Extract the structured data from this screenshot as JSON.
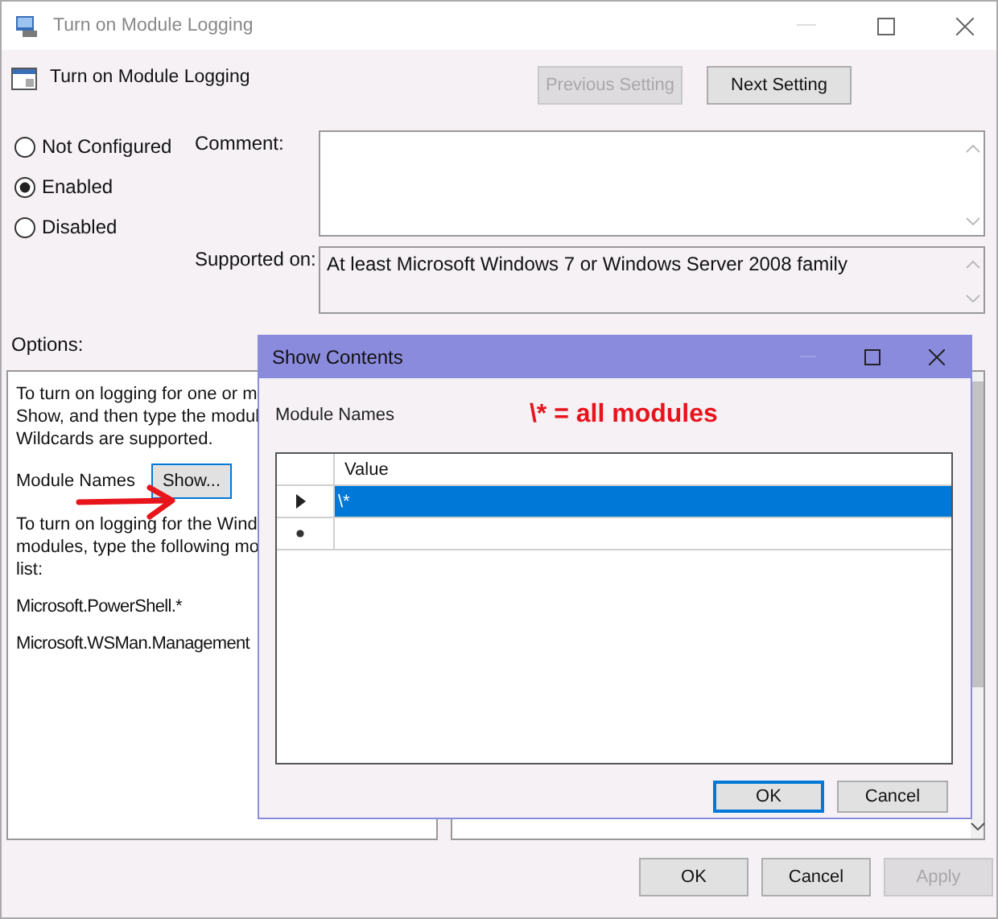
{
  "window": {
    "title": "Turn on Module Logging"
  },
  "header": {
    "title": "Turn on Module Logging",
    "buttons": [
      {
        "label": "Previous Setting",
        "disabled": true
      },
      {
        "label": "Next Setting",
        "disabled": false
      }
    ]
  },
  "state_options": [
    {
      "label": "Not Configured",
      "selected": false
    },
    {
      "label": "Enabled",
      "selected": true
    },
    {
      "label": "Disabled",
      "selected": false
    }
  ],
  "comment": {
    "label": "Comment:"
  },
  "supported_on": {
    "label": "Supported on:",
    "value": "At least Microsoft Windows 7 or Windows Server 2008 family"
  },
  "options": {
    "label": "Options:",
    "intro_lines": [
      "To turn on logging for one or m",
      "Show, and then type the modul",
      "Wildcards are supported."
    ],
    "field_label": "Module Names",
    "show_button": "Show...",
    "note_lines": [
      "To turn on logging for the Wind",
      "modules, type the following mo",
      "list:"
    ],
    "module_examples": [
      "Microsoft.PowerShell.*",
      "Microsoft.WSMan.Management"
    ]
  },
  "footer_buttons": [
    {
      "label": "OK",
      "disabled": false
    },
    {
      "label": "Cancel",
      "disabled": false
    },
    {
      "label": "Apply",
      "disabled": true
    }
  ],
  "show_contents": {
    "title": "Show Contents",
    "label": "Module Names",
    "annotation": "\\* = all modules",
    "columns": [
      "Value"
    ],
    "rows": [
      {
        "kind": "current",
        "value": "\\*",
        "selected": true
      },
      {
        "kind": "new",
        "selected": false
      }
    ],
    "buttons": [
      {
        "label": "OK",
        "default": true
      },
      {
        "label": "Cancel",
        "default": false
      }
    ]
  }
}
